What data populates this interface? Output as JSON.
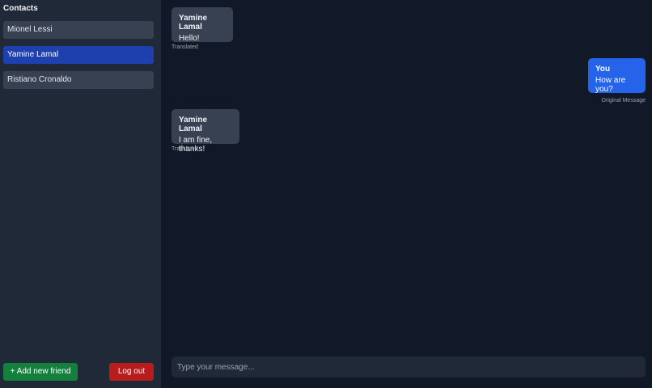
{
  "sidebar": {
    "title": "Contacts",
    "contacts": [
      {
        "name": "Mionel Lessi",
        "active": false
      },
      {
        "name": "Yamine Lamal",
        "active": true
      },
      {
        "name": "Ristiano Cronaldo",
        "active": false
      }
    ],
    "add_friend_label": "+ Add new friend",
    "logout_label": "Log out"
  },
  "chat": {
    "messages": [
      {
        "sender": "Yamine Lamal",
        "text": "Hello!",
        "meta": "Translated",
        "direction": "incoming"
      },
      {
        "sender": "You",
        "text": "How are you?",
        "meta": "Original Message",
        "direction": "outgoing"
      },
      {
        "sender": "Yamine Lamal",
        "text": "I am fine, thanks!",
        "meta": "Translated",
        "direction": "incoming"
      }
    ],
    "composer": {
      "placeholder": "Type your message...",
      "value": ""
    }
  },
  "colors": {
    "background": "#111827",
    "sidebar": "#1f2937",
    "active_contact": "#1e40af",
    "outgoing_bubble": "#2563eb",
    "incoming_bubble": "#374151",
    "add_button": "#15803d",
    "logout_button": "#b91c1c"
  }
}
